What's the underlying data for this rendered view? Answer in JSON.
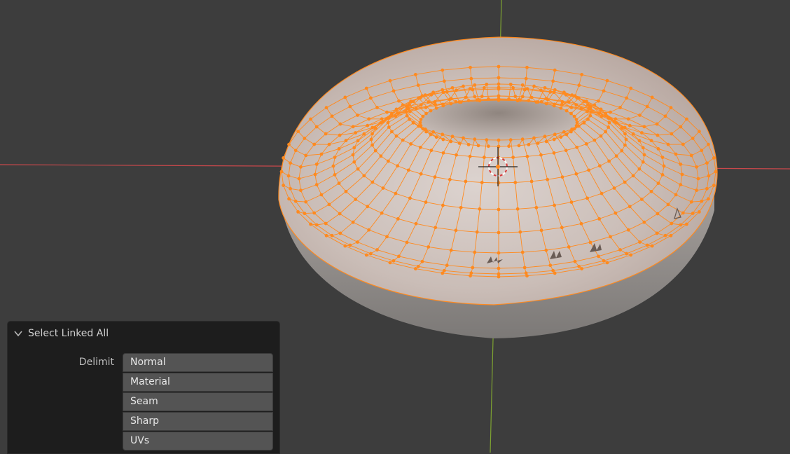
{
  "operator_panel": {
    "title": "Select Linked All",
    "delimit_label": "Delimit",
    "options": [
      "Normal",
      "Material",
      "Seam",
      "Sharp",
      "UVs"
    ]
  },
  "colors": {
    "background": "#3d3d3d",
    "selection": "#ff8a1f",
    "x_axis": "#c8484b",
    "y_axis": "#7ea331",
    "mesh_surface": "#c9bdb8"
  },
  "icons": {
    "panel_toggle": "chevron-down-icon",
    "cursor": "3d-cursor-icon"
  }
}
